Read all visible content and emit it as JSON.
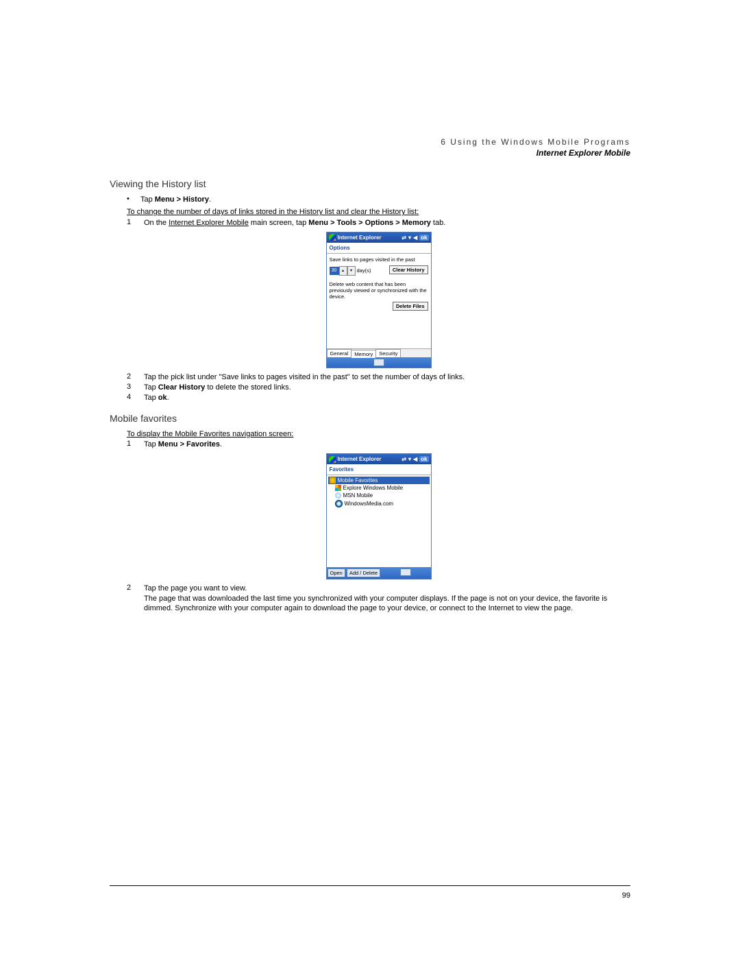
{
  "header": {
    "chapter": "6 Using the Windows Mobile Programs",
    "section": "Internet Explorer Mobile"
  },
  "heading1": "Viewing the History list",
  "bullet1_pre": "Tap ",
  "bullet1_bold": "Menu > History",
  "bullet1_post": ".",
  "underline1": "To change the number of days of links stored in the History list and clear the History list:",
  "step1": {
    "num": "1",
    "t1": "On the ",
    "u": "Internet Explorer Mobile",
    "t2": " main screen, tap ",
    "b1": "Menu > Tools > Options > Memory",
    "t3": " tab."
  },
  "screen1": {
    "title": "Internet Explorer",
    "ok": "ok",
    "subtitle": "Options",
    "label1": "Save links to pages visited in the past",
    "days_val": "30",
    "days_unit": "day(s)",
    "btn_clear": "Clear History",
    "label2": "Delete web content that has been previously viewed or synchronized with the device.",
    "btn_delete": "Delete Files",
    "tabs": [
      "General",
      "Memory",
      "Security"
    ]
  },
  "step2": {
    "num": "2",
    "text": "Tap the pick list under \"Save links to pages visited in the past\" to set the number of days of links."
  },
  "step3": {
    "num": "3",
    "t1": "Tap ",
    "b": "Clear History",
    "t2": " to delete the stored links."
  },
  "step4": {
    "num": "4",
    "t1": "Tap ",
    "b": "ok",
    "t2": "."
  },
  "heading2": "Mobile favorites",
  "underline2": "To display the Mobile Favorites navigation screen:",
  "fstep1": {
    "num": "1",
    "t1": "Tap ",
    "b": "Menu > Favorites",
    "t2": "."
  },
  "screen2": {
    "title": "Internet Explorer",
    "ok": "ok",
    "subtitle": "Favorites",
    "items": [
      {
        "label": "Mobile Favorites",
        "sel": true,
        "icon": "star",
        "root": true
      },
      {
        "label": "Explore Windows Mobile",
        "icon": "winlogo"
      },
      {
        "label": "MSN Mobile",
        "icon": "msn"
      },
      {
        "label": "WindowsMedia.com",
        "icon": "wmedia"
      }
    ],
    "soft_left": "Open",
    "soft_right": "Add / Delete"
  },
  "fstep2": {
    "num": "2",
    "line1": "Tap the page you want to view.",
    "line2": "The page that was downloaded the last time you synchronized with your computer displays. If the page is not on your device, the favorite is dimmed. Synchronize with your computer again to download the page to your device, or connect to the Internet to view the page."
  },
  "page_number": "99"
}
